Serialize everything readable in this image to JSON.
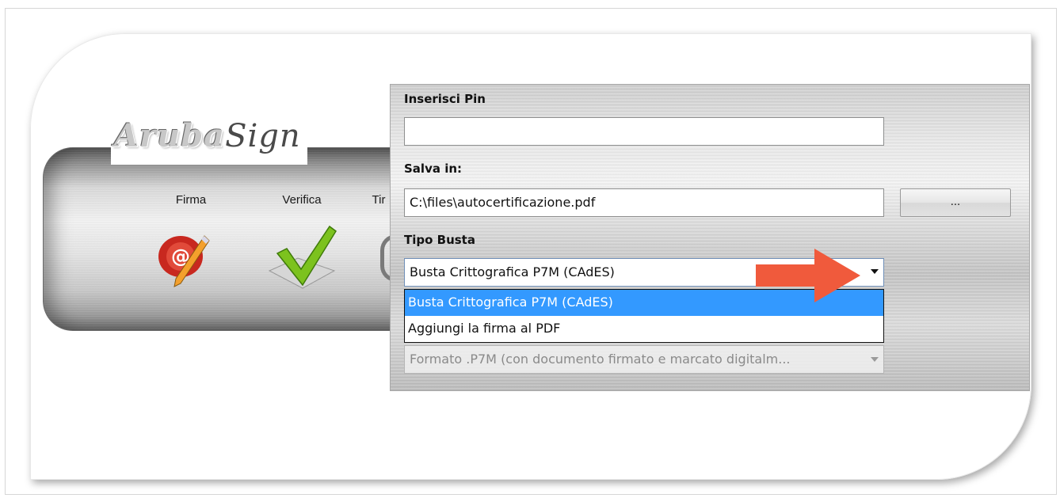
{
  "app": {
    "logo_text": "Aruba",
    "logo_sign": "Sign"
  },
  "toolbar": {
    "tools": [
      {
        "label": "Firma",
        "icon": "wax-seal-pen-icon"
      },
      {
        "label": "Verifica",
        "icon": "green-checkmark-icon"
      },
      {
        "label": "Tir",
        "icon": "stamp-icon"
      }
    ]
  },
  "form": {
    "pin_label": "Inserisci Pin",
    "pin_value": "",
    "save_label": "Salva in:",
    "save_path": "C:\\files\\autocertificazione.pdf",
    "browse_label": "...",
    "envelope_label": "Tipo Busta",
    "envelope_selected": "Busta Crittografica P7M (CAdES)",
    "envelope_options": [
      "Busta Crittografica P7M (CAdES)",
      "Aggiungi la firma al PDF"
    ],
    "format_selected": "Formato .P7M (con documento firmato e marcato digitalm..."
  },
  "colors": {
    "highlight": "#3399ff",
    "arrow": "#f05a3c",
    "check": "#7cc21e",
    "seal": "#d8332c"
  }
}
